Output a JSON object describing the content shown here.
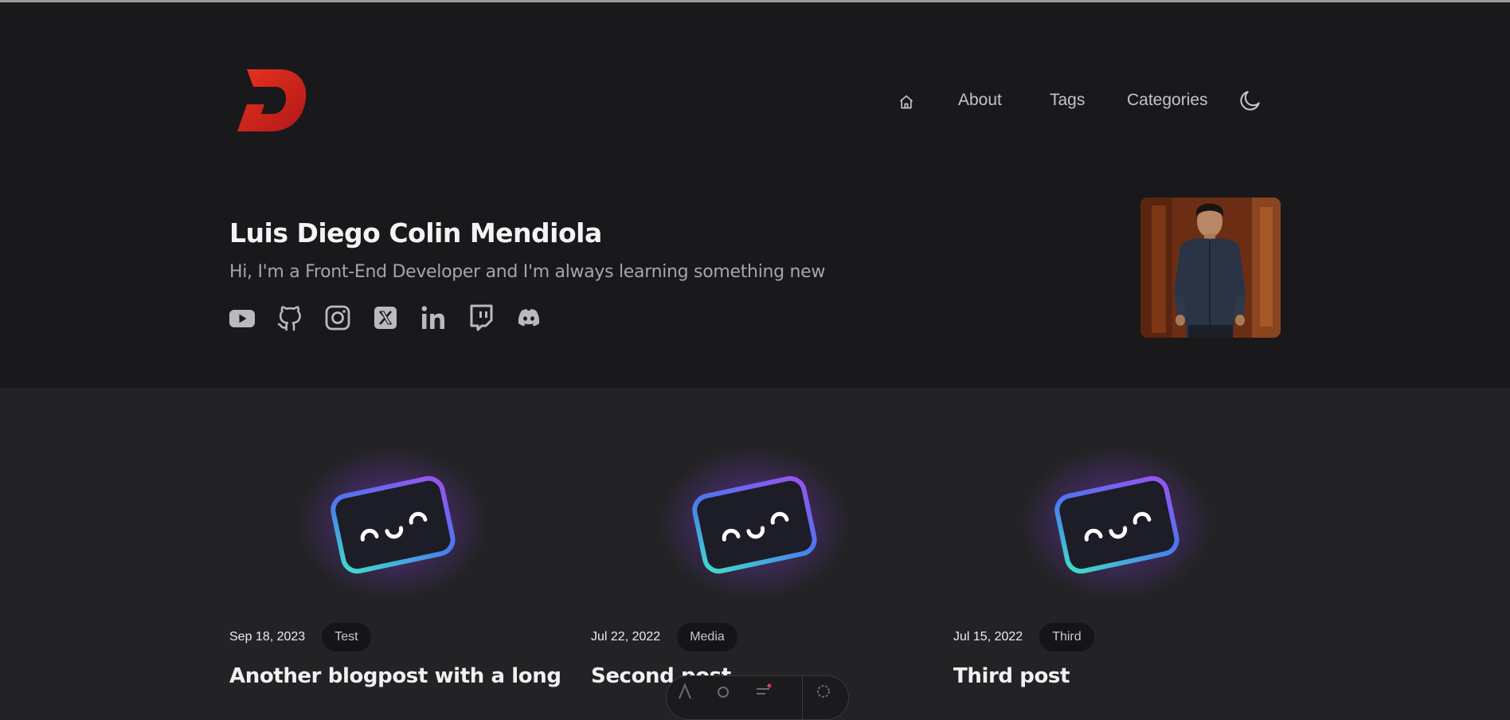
{
  "header": {
    "logo_icon": "d-logo-icon",
    "nav": {
      "home_icon": "home-icon",
      "items": [
        {
          "label": "About"
        },
        {
          "label": "Tags"
        },
        {
          "label": "Categories"
        }
      ],
      "theme_icon": "moon-icon"
    }
  },
  "intro": {
    "name": "Luis Diego Colin Mendiola",
    "tagline": "Hi, I'm a Front-End Developer and I'm always learning something new",
    "socials": [
      {
        "icon": "youtube-icon"
      },
      {
        "icon": "github-icon"
      },
      {
        "icon": "instagram-icon"
      },
      {
        "icon": "x-icon"
      },
      {
        "icon": "linkedin-icon"
      },
      {
        "icon": "twitch-icon"
      },
      {
        "icon": "discord-icon"
      }
    ],
    "avatar": "profile-photo"
  },
  "posts": [
    {
      "date": "Sep 18, 2023",
      "tag": "Test",
      "title": "Another blogpost with a long"
    },
    {
      "date": "Jul 22, 2022",
      "tag": "Media",
      "title": "Second post"
    },
    {
      "date": "Jul 15, 2022",
      "tag": "Third",
      "title": "Third post"
    }
  ],
  "colors": {
    "header_bg": "#19191b",
    "page_bg": "#232325",
    "logo_red": "#d4251f",
    "text_primary": "#f3f3f5",
    "text_muted": "#a5a5ab"
  }
}
